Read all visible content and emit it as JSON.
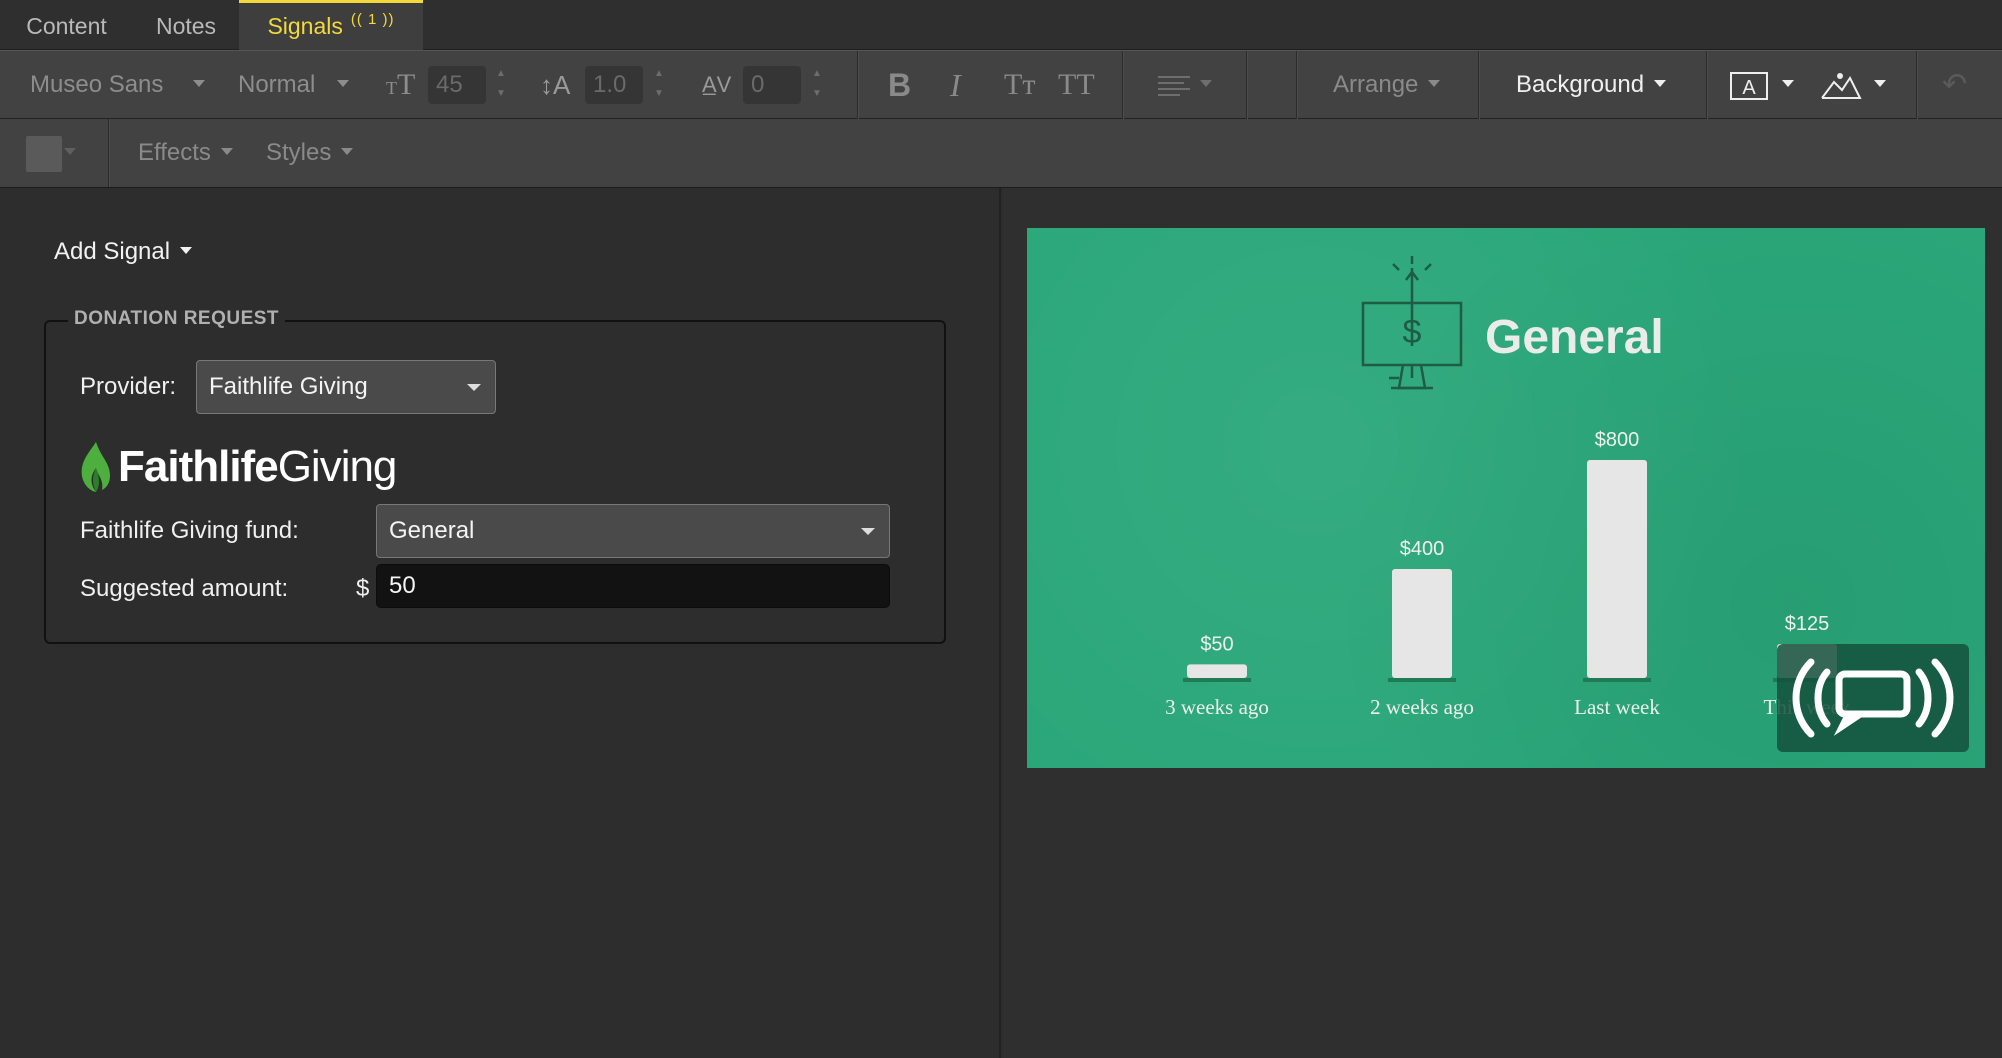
{
  "tabs": [
    {
      "label": "Content",
      "active": false
    },
    {
      "label": "Notes",
      "active": false
    },
    {
      "label": "Signals",
      "active": true,
      "badge": "(( 1 ))"
    }
  ],
  "toolbar": {
    "font_family": "Museo Sans",
    "font_style": "Normal",
    "font_size": "45",
    "line_height": "1.0",
    "letter_spacing": "0",
    "bold_glyph": "B",
    "italic_glyph": "I",
    "small_caps_glyph": "Tт",
    "all_caps_glyph": "TT",
    "arrange_label": "Arrange",
    "background_label": "Background",
    "effects_label": "Effects",
    "styles_label": "Styles"
  },
  "signals": {
    "add_signal_label": "Add Signal",
    "section_title": "DONATION REQUEST",
    "provider_label": "Provider:",
    "provider_value": "Faithlife Giving",
    "logo_text_bold": "Faithlife",
    "logo_text_light": "Giving",
    "fund_label": "Faithlife Giving fund:",
    "fund_value": "General",
    "amount_label": "Suggested amount:",
    "currency_symbol": "$",
    "amount_value": "50"
  },
  "slide": {
    "title": "General",
    "background_color": "#2aa77a"
  },
  "chart_data": {
    "type": "bar",
    "title": "General",
    "categories": [
      "3 weeks ago",
      "2 weeks ago",
      "Last week",
      "This week"
    ],
    "values": [
      50,
      400,
      800,
      125
    ],
    "value_labels": [
      "$50",
      "$400",
      "$800",
      "$125"
    ],
    "ylim": [
      0,
      800
    ],
    "bar_color": "#e6e6e6",
    "grid": false
  }
}
